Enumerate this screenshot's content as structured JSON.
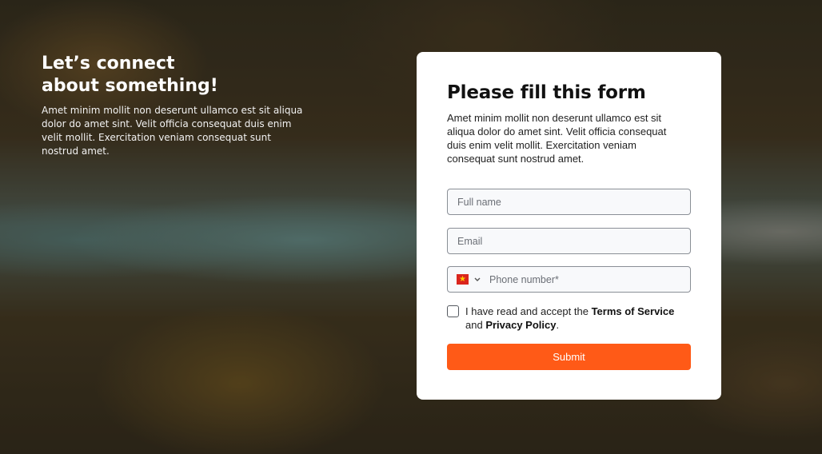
{
  "hero": {
    "title": "Let’s connect about something!",
    "text": "Amet minim mollit non deserunt ullamco est sit aliqua dolor do amet sint. Velit officia consequat duis enim velit mollit. Exercitation veniam consequat sunt nostrud amet."
  },
  "form": {
    "title": "Please fill this form",
    "description": "Amet minim mollit non deserunt ullamco est sit aliqua dolor do amet sint. Velit officia consequat duis enim velit mollit. Exercitation veniam consequat sunt nostrud amet.",
    "full_name": {
      "placeholder": "Full name",
      "value": ""
    },
    "email": {
      "placeholder": "Email",
      "value": ""
    },
    "phone": {
      "placeholder": "Phone number*",
      "value": "",
      "country_flag": "vietnam-flag-icon"
    },
    "terms": {
      "prefix": "I have read and accept the ",
      "tos_link": "Terms of Service",
      "middle": " and ",
      "privacy_link": "Privacy Policy",
      "suffix": ".",
      "checked": false
    },
    "submit_label": "Submit"
  },
  "colors": {
    "accent": "#ff5a17",
    "card_bg": "#ffffff",
    "field_border": "#8a8f96"
  }
}
